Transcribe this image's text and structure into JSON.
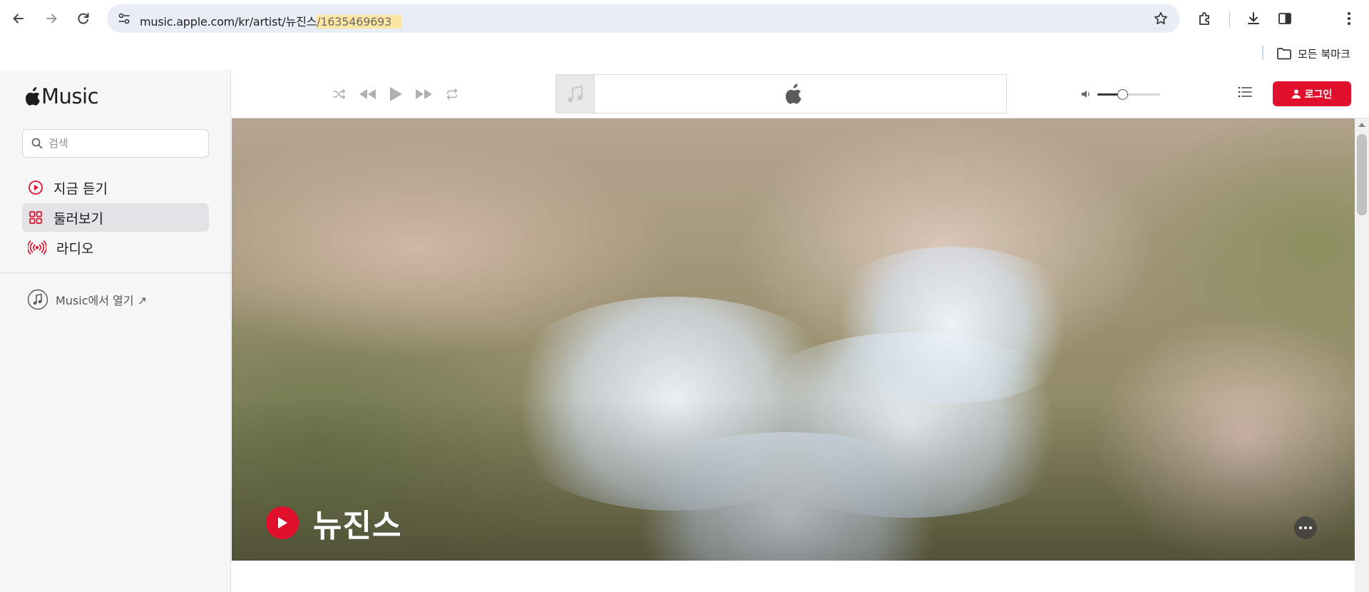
{
  "browser": {
    "url_main": "music.apple.com/kr/artist/뉴진스",
    "url_highlight": "/1635469693",
    "bookmarks_all_label": "모든 북마크"
  },
  "app": {
    "logo_text": "Music",
    "search_placeholder": "검색",
    "nav": [
      {
        "label": "지금 듣기",
        "icon": "play-circle-icon",
        "active": false
      },
      {
        "label": "둘러보기",
        "icon": "grid-icon",
        "active": true
      },
      {
        "label": "라디오",
        "icon": "radio-waves-icon",
        "active": false
      }
    ],
    "open_in_music": "Music에서 열기 ↗",
    "login_label": "로그인",
    "volume_level": 0.4
  },
  "hero": {
    "artist_name": "뉴진스"
  },
  "colors": {
    "accent": "#e0102c",
    "sidebar_bg": "#f7f7f8",
    "omnibox_bg": "#e9edf6",
    "url_highlight_bg": "#fbe7a3"
  }
}
